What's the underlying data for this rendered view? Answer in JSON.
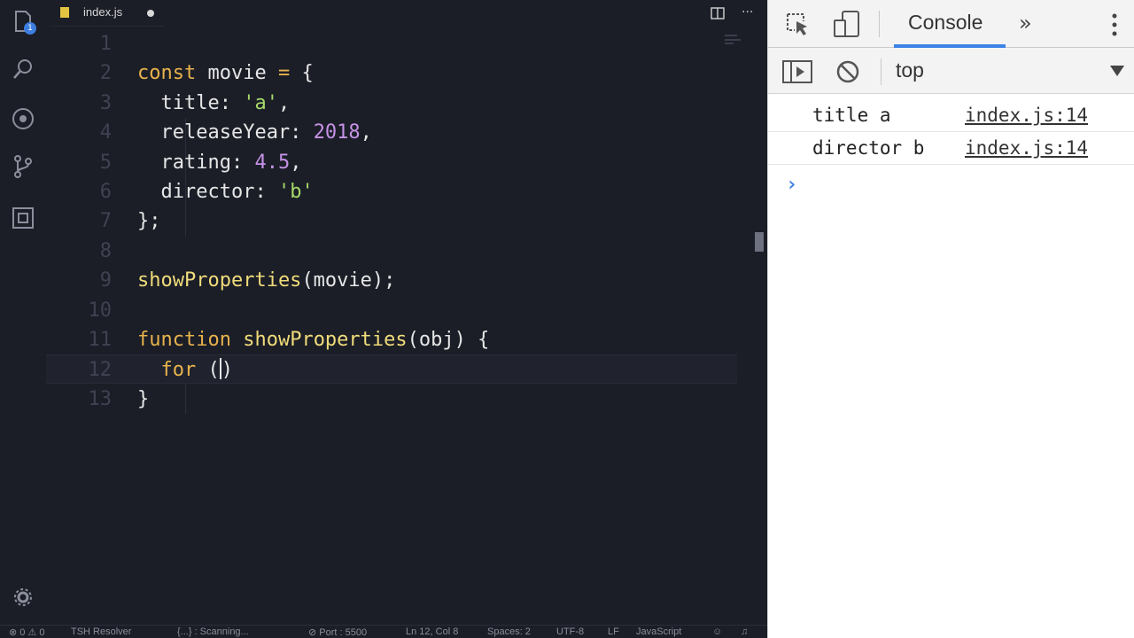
{
  "editor": {
    "tab": {
      "filename": "index.js"
    },
    "activity_badge": "1",
    "lines": [
      {
        "n": "1",
        "tokens": []
      },
      {
        "n": "2",
        "tokens": [
          [
            "kw",
            "const"
          ],
          [
            "plain",
            " movie "
          ],
          [
            "op",
            "="
          ],
          [
            "plain",
            " {"
          ]
        ]
      },
      {
        "n": "3",
        "tokens": [
          [
            "plain",
            "  title: "
          ],
          [
            "str",
            "'a'"
          ],
          [
            "plain",
            ","
          ]
        ]
      },
      {
        "n": "4",
        "tokens": [
          [
            "plain",
            "  releaseYear: "
          ],
          [
            "num",
            "2018"
          ],
          [
            "plain",
            ","
          ]
        ]
      },
      {
        "n": "5",
        "tokens": [
          [
            "plain",
            "  rating: "
          ],
          [
            "num",
            "4.5"
          ],
          [
            "plain",
            ","
          ]
        ]
      },
      {
        "n": "6",
        "tokens": [
          [
            "plain",
            "  director: "
          ],
          [
            "str",
            "'b'"
          ]
        ]
      },
      {
        "n": "7",
        "tokens": [
          [
            "plain",
            "};"
          ]
        ]
      },
      {
        "n": "8",
        "tokens": []
      },
      {
        "n": "9",
        "tokens": [
          [
            "fn",
            "showProperties"
          ],
          [
            "plain",
            "(movie);"
          ]
        ]
      },
      {
        "n": "10",
        "tokens": []
      },
      {
        "n": "11",
        "tokens": [
          [
            "kw",
            "function"
          ],
          [
            "plain",
            " "
          ],
          [
            "fn",
            "showProperties"
          ],
          [
            "plain",
            "(obj) {"
          ]
        ]
      },
      {
        "n": "12",
        "tokens": [
          [
            "kw",
            "  for"
          ],
          [
            "plain",
            " ("
          ],
          [
            "cursor",
            ""
          ],
          [
            "plain",
            ")"
          ]
        ],
        "current": true
      },
      {
        "n": "13",
        "tokens": [
          [
            "plain",
            "}"
          ]
        ]
      }
    ]
  },
  "status": {
    "problems": "⊗ 0 ⚠ 0",
    "resolver": "TSH Resolver",
    "scanning": "{...} : Scanning...",
    "port": "⊘ Port : 5500",
    "position": "Ln 12, Col 8",
    "spaces": "Spaces: 2",
    "encoding": "UTF-8",
    "eol": "LF",
    "language": "JavaScript"
  },
  "devtools": {
    "tab_console": "Console",
    "overflow": "»",
    "context": "top",
    "logs": [
      {
        "message": "title a",
        "source": "index.js:14"
      },
      {
        "message": "director b",
        "source": "index.js:14"
      }
    ],
    "prompt": "›"
  },
  "colors": {
    "editor_bg": "#1b1e27",
    "keyword": "#e8b24c",
    "string": "#a6d96a",
    "number": "#c592e6",
    "function": "#f0dc7a",
    "accent": "#3b82e6"
  }
}
